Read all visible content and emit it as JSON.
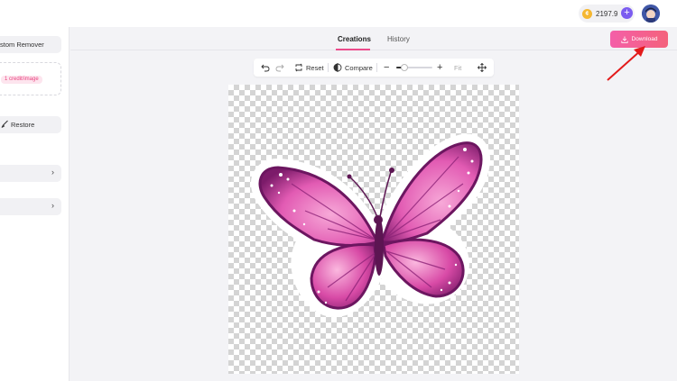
{
  "header": {
    "credits": "2197.9",
    "add_credits_icon": "plus-circle-icon",
    "avatar_icon": "avatar-icon"
  },
  "left_panel": {
    "remover_button": "stom Remover",
    "credit_tag": "1 credit/image",
    "restore_button": "Restore"
  },
  "tabs": [
    {
      "label": "Creations",
      "active": true
    },
    {
      "label": "History",
      "active": false
    }
  ],
  "download": {
    "label": "Download",
    "color": "#f45fa8"
  },
  "toolbar": {
    "reset": "Reset",
    "compare": "Compare",
    "fit": "Fit",
    "zoom": 0.22
  },
  "colors": {
    "accent": "#ec4b8b",
    "arrow": "#e31b1b"
  }
}
